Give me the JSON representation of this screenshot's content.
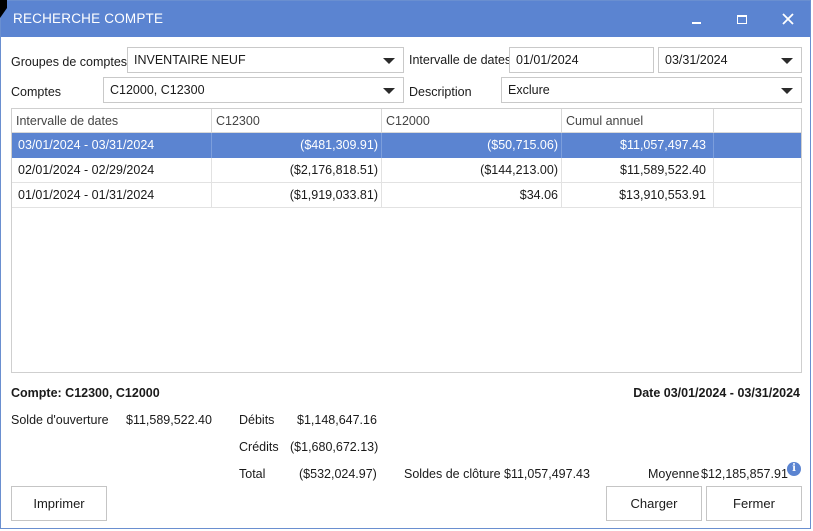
{
  "window": {
    "title": "RECHERCHE COMPTE"
  },
  "filters": {
    "groups_label": "Groupes de comptes",
    "groups_value": "INVENTAIRE NEUF",
    "accounts_label": "Comptes",
    "accounts_value": "C12000, C12300",
    "date_range_label": "Intervalle de dates",
    "date_from": "01/01/2024",
    "date_to": "03/31/2024",
    "description_label": "Description",
    "description_value": "Exclure"
  },
  "grid": {
    "columns": [
      "Intervalle de dates",
      "C12300",
      "C12000",
      "Cumul annuel"
    ],
    "rows": [
      {
        "range": "03/01/2024 - 03/31/2024",
        "c12300": "($481,309.91)",
        "c12000": "($50,715.06)",
        "ytd": "$11,057,497.43",
        "selected": true
      },
      {
        "range": "02/01/2024 - 02/29/2024",
        "c12300": "($2,176,818.51)",
        "c12000": "($144,213.00)",
        "ytd": "$11,589,522.40",
        "selected": false
      },
      {
        "range": "01/01/2024 - 01/31/2024",
        "c12300": "($1,919,033.81)",
        "c12000": "$34.06",
        "ytd": "$13,910,553.91",
        "selected": false
      }
    ]
  },
  "summary": {
    "account_heading": "Compte: C12300, C12000",
    "date_heading": "Date 03/01/2024 - 03/31/2024",
    "opening_label": "Solde d'ouverture",
    "opening_value": "$11,589,522.40",
    "debits_label": "Débits",
    "debits_value": "$1,148,647.16",
    "credits_label": "Crédits",
    "credits_value": "($1,680,672.13)",
    "total_label": "Total",
    "total_value": "($532,024.97)",
    "closing_label": "Soldes de clôture",
    "closing_value": "$11,057,497.43",
    "average_label": "Moyenne",
    "average_value": "$12,185,857.91"
  },
  "buttons": {
    "print": "Imprimer",
    "load": "Charger",
    "close": "Fermer"
  },
  "icons": {
    "minimize": "minimize-icon",
    "maximize": "maximize-icon",
    "close": "close-icon",
    "info": "info-icon",
    "dropdown": "chevron-down-icon"
  },
  "colors": {
    "accent": "#5b84d1",
    "selected_row": "#5b84d1"
  }
}
